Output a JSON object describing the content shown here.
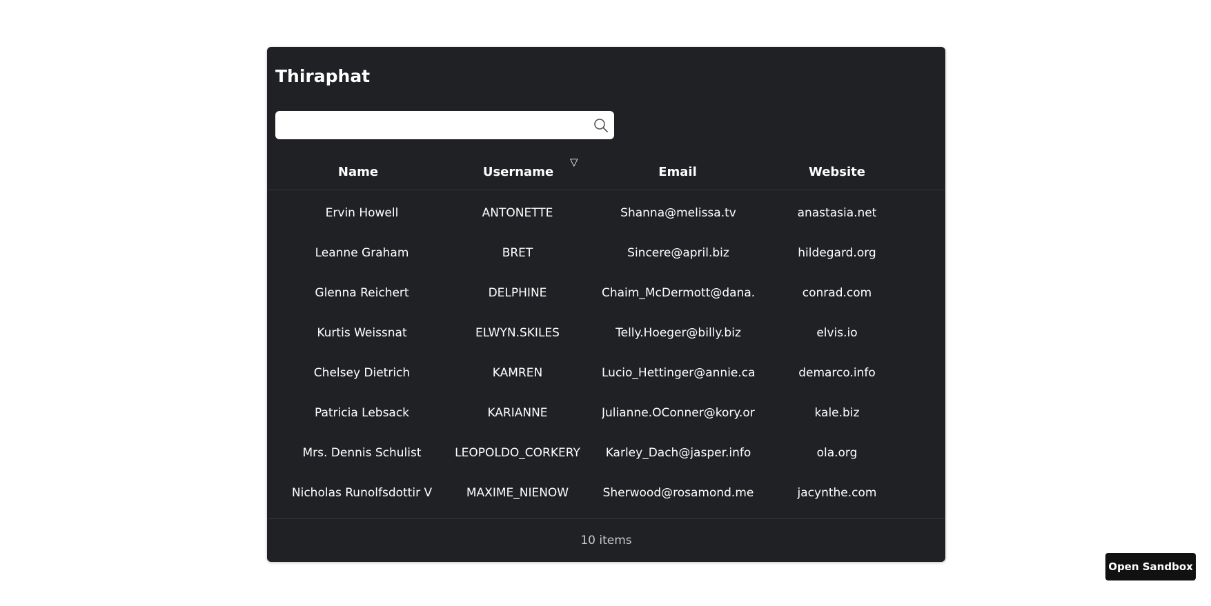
{
  "app": {
    "title": "Thiraphat"
  },
  "search": {
    "value": "",
    "placeholder": "",
    "icon": "search-icon"
  },
  "table": {
    "columns": [
      "Name",
      "Username",
      "Email",
      "Website"
    ],
    "sort_indicator": "▽",
    "rows": [
      [
        "Ervin Howell",
        "ANTONETTE",
        "Shanna@melissa.tv",
        "anastasia.net"
      ],
      [
        "Leanne Graham",
        "BRET",
        "Sincere@april.biz",
        "hildegard.org"
      ],
      [
        "Glenna Reichert",
        "DELPHINE",
        "Chaim_McDermott@dana.io",
        "conrad.com"
      ],
      [
        "Kurtis Weissnat",
        "ELWYN.SKILES",
        "Telly.Hoeger@billy.biz",
        "elvis.io"
      ],
      [
        "Chelsey Dietrich",
        "KAMREN",
        "Lucio_Hettinger@annie.ca",
        "demarco.info"
      ],
      [
        "Patricia Lebsack",
        "KARIANNE",
        "Julianne.OConner@kory.org",
        "kale.biz"
      ],
      [
        "Mrs. Dennis Schulist",
        "LEOPOLDO_CORKERY",
        "Karley_Dach@jasper.info",
        "ola.org"
      ],
      [
        "Nicholas Runolfsdottir V",
        "MAXIME_NIENOW",
        "Sherwood@rosamond.me",
        "jacynthe.com"
      ]
    ]
  },
  "footer": {
    "count": "10 items"
  },
  "sandbox": {
    "label": "Open Sandbox"
  },
  "colors": {
    "panel_bg": "#202124",
    "page_bg": "#ffffff",
    "text": "#ffffff",
    "button_bg": "#111111"
  }
}
